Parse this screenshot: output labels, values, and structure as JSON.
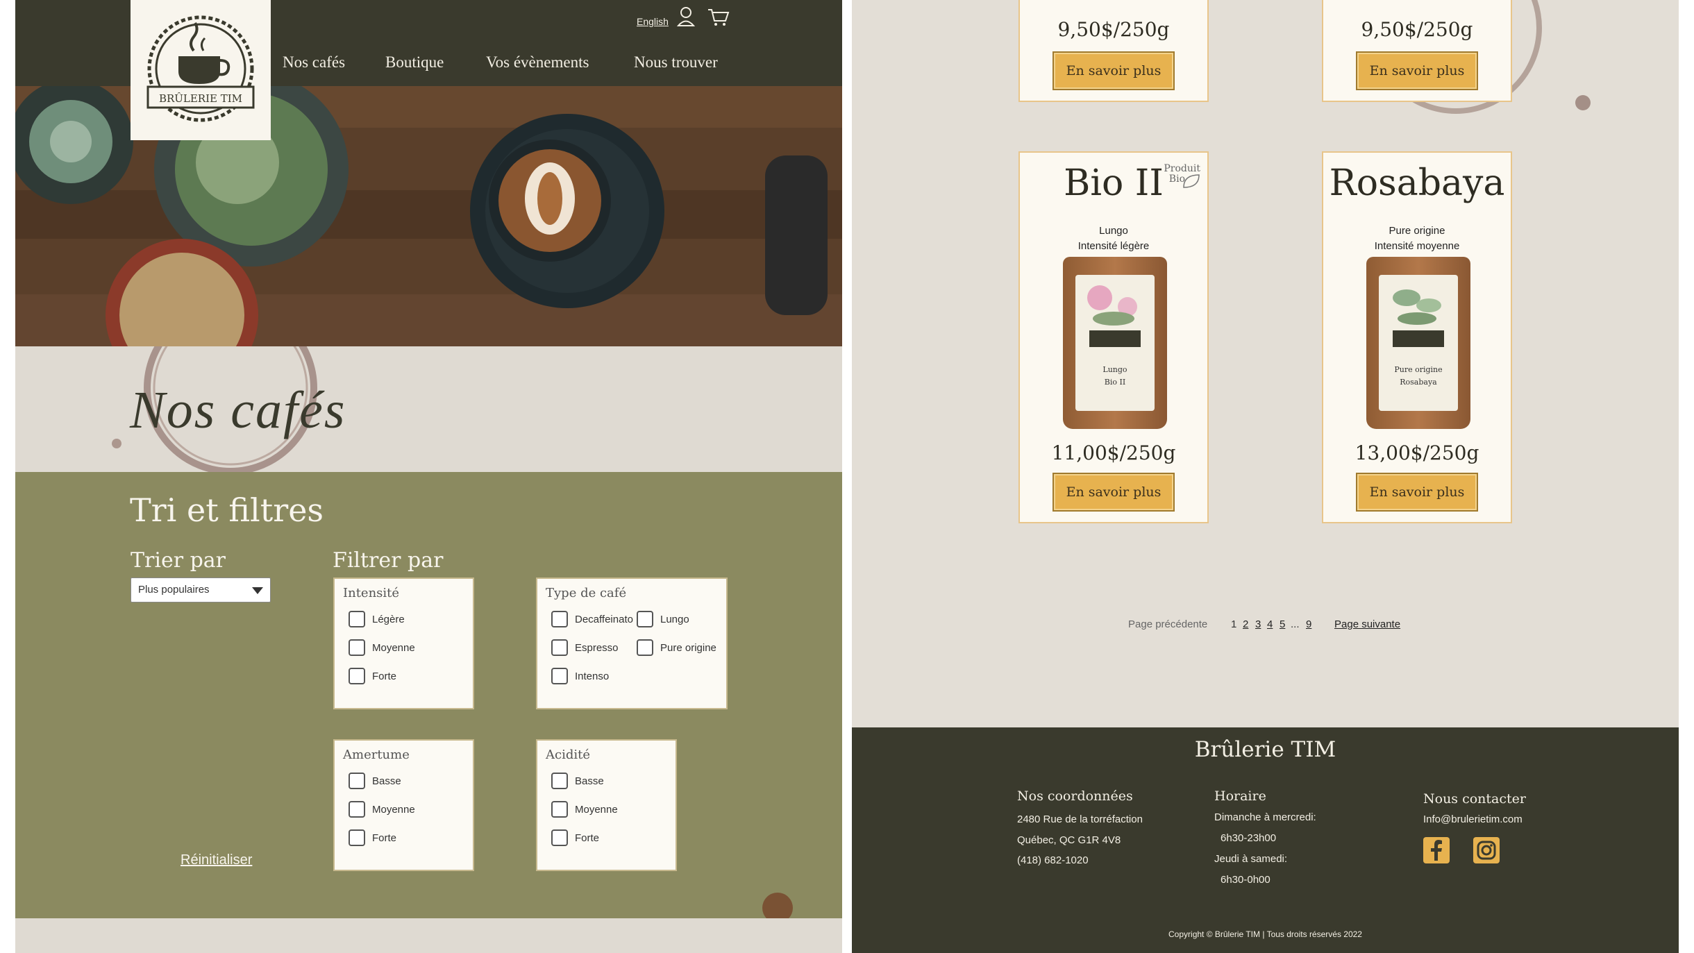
{
  "left": {
    "header": {
      "brand": "BRÛLERIE TIM",
      "nav": [
        "Nos cafés",
        "Boutique",
        "Vos évènements",
        "Nous trouver"
      ],
      "lang": "English",
      "icons": [
        "user-icon",
        "cart-icon"
      ]
    },
    "page_title": "Nos cafés",
    "filters": {
      "title": "Tri et filtres",
      "sort_label": "Trier par",
      "sort_value": "Plus populaires",
      "filter_label": "Filtrer par",
      "groups": [
        {
          "title": "Intensité",
          "options": [
            "Légère",
            "Moyenne",
            "Forte"
          ]
        },
        {
          "title": "Type de café",
          "options": [
            "Decaffeinato",
            "Lungo",
            "Espresso",
            "Pure origine",
            "Intenso"
          ]
        },
        {
          "title": "Amertume",
          "options": [
            "Basse",
            "Moyenne",
            "Forte"
          ]
        },
        {
          "title": "Acidité",
          "options": [
            "Basse",
            "Moyenne",
            "Forte"
          ]
        }
      ],
      "reset": "Réinitialiser"
    }
  },
  "right": {
    "products_top": [
      {
        "price": "9,50$/250g",
        "button": "En savoir plus"
      },
      {
        "price": "9,50$/250g",
        "button": "En savoir plus"
      }
    ],
    "products": [
      {
        "name": "Bio II",
        "badge_line1": "Produit",
        "badge_line2": "Bio",
        "type": "Lungo",
        "intensity": "Intensité légère",
        "bag_type": "Lungo",
        "bag_name": "Bio II",
        "price": "11,00$/250g",
        "button": "En savoir plus"
      },
      {
        "name": "Rosabaya",
        "type": "Pure origine",
        "intensity": "Intensité moyenne",
        "bag_type": "Pure origine",
        "bag_name": "Rosabaya",
        "price": "13,00$/250g",
        "button": "En savoir plus"
      }
    ],
    "pagination": {
      "prev": "Page précédente",
      "pages": [
        "1",
        "2",
        "3",
        "4",
        "5",
        "...",
        "9"
      ],
      "next": "Page suivante"
    },
    "footer": {
      "brand": "Brûlerie TIM",
      "contact_title": "Nos coordonnées",
      "address1": "2480 Rue de la torréfaction",
      "address2": "Québec, QC G1R 4V8",
      "phone": "(418) 682-1020",
      "hours_title": "Horaire",
      "hours1_label": "Dimanche à mercredi:",
      "hours1": "6h30-23h00",
      "hours2_label": "Jeudi à samedi:",
      "hours2": "6h30-0h00",
      "contact_us_title": "Nous contacter",
      "email": "Info@brulerietim.com",
      "copyright": "Copyright © Brûlerie TIM | Tous droits réservés 2022"
    }
  }
}
